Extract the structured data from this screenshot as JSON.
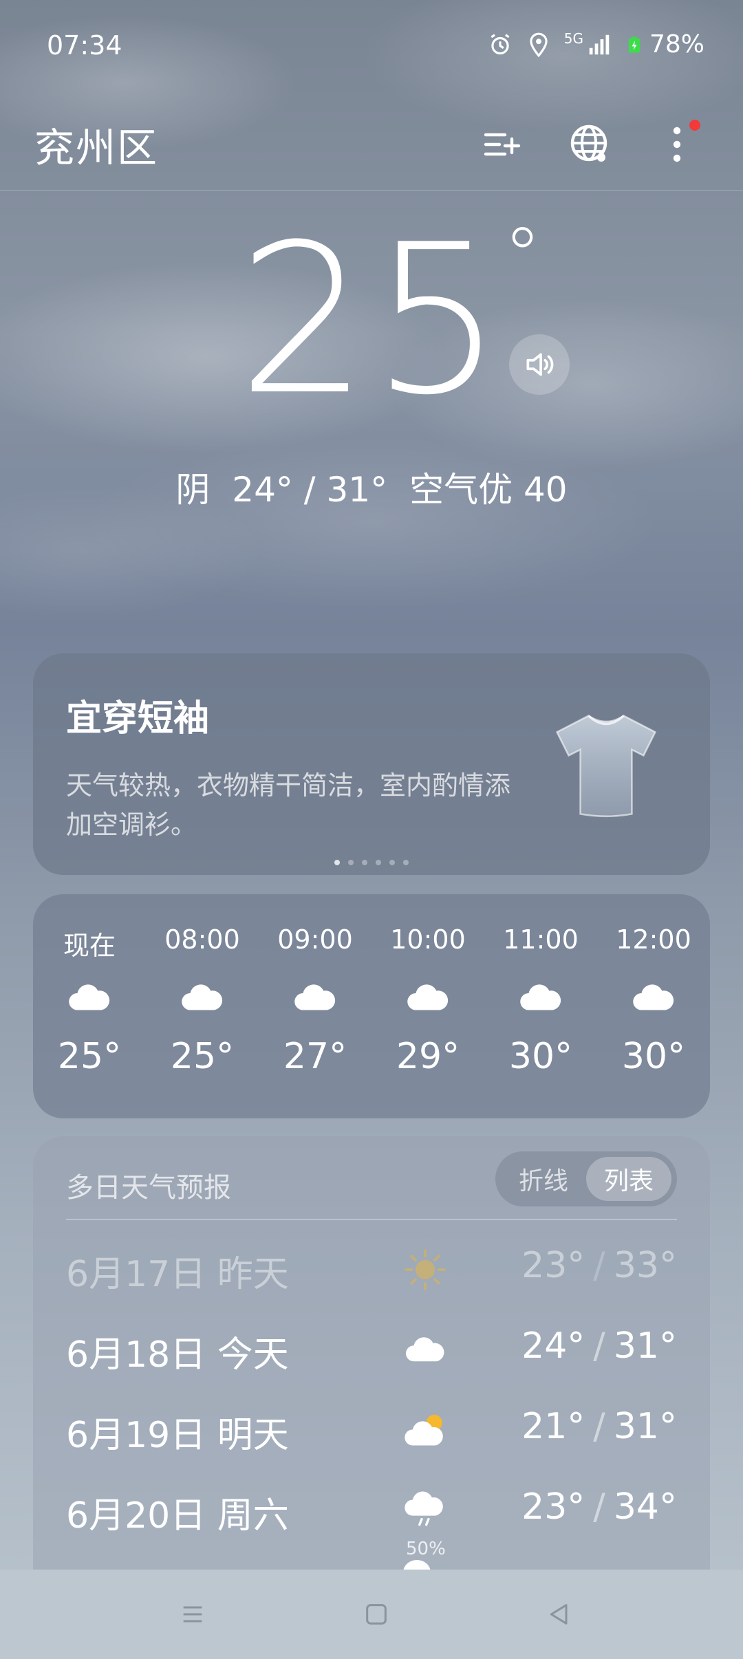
{
  "status_bar": {
    "time": "07:34",
    "network": "5G",
    "battery": "78%"
  },
  "header": {
    "city": "兖州区"
  },
  "current": {
    "temp": "25",
    "degree_symbol": "°",
    "condition": "阴",
    "range": "24° / 31°",
    "air_quality": "空气优 40"
  },
  "clothing": {
    "title": "宜穿短袖",
    "description": "天气较热，衣物精干简洁，室内酌情添加空调衫。",
    "page_count": 6,
    "active_page": 1
  },
  "hourly": [
    {
      "label": "现在",
      "icon": "cloudy-icon",
      "temp": "25°"
    },
    {
      "label": "08:00",
      "icon": "cloudy-icon",
      "temp": "25°"
    },
    {
      "label": "09:00",
      "icon": "cloudy-icon",
      "temp": "27°"
    },
    {
      "label": "10:00",
      "icon": "cloudy-icon",
      "temp": "29°"
    },
    {
      "label": "11:00",
      "icon": "cloudy-icon",
      "temp": "30°"
    },
    {
      "label": "12:00",
      "icon": "cloudy-icon",
      "temp": "30°"
    }
  ],
  "daily": {
    "title": "多日天气预报",
    "toggle": {
      "option_line": "折线",
      "option_list": "列表",
      "selected": "列表"
    },
    "rows": [
      {
        "date": "6月17日 昨天",
        "icon": "sunny-icon",
        "low": "23°",
        "high": "33°",
        "past": true
      },
      {
        "date": "6月18日 今天",
        "icon": "cloudy-icon",
        "low": "24°",
        "high": "31°"
      },
      {
        "date": "6月19日 明天",
        "icon": "partly-cloudy-icon",
        "low": "21°",
        "high": "31°"
      },
      {
        "date": "6月20日 周六",
        "icon": "rain-icon",
        "precip": "50%",
        "low": "23°",
        "high": "34°"
      }
    ]
  },
  "colors": {
    "alert_dot": "#f23a3a",
    "battery_green": "#3ddc4a",
    "sun_yellow": "#f5b82e"
  }
}
